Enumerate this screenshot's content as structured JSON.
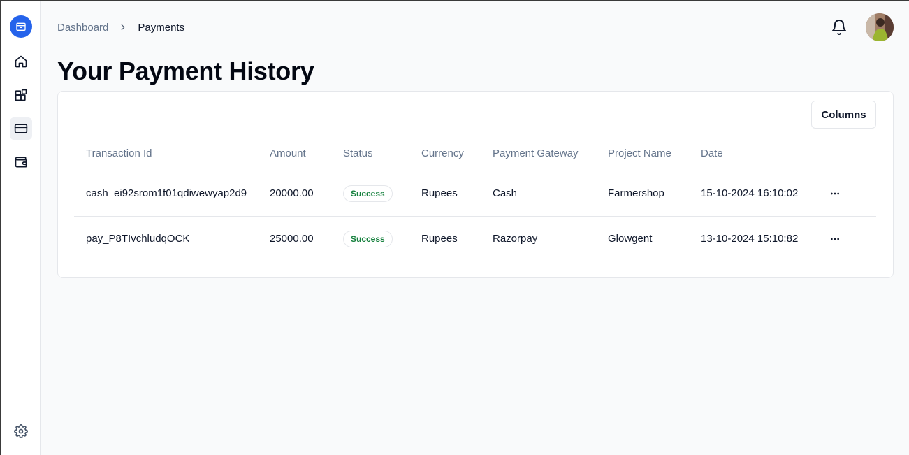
{
  "breadcrumb": {
    "parent": "Dashboard",
    "current": "Payments"
  },
  "page_title": "Your Payment History",
  "toolbar": {
    "columns_label": "Columns"
  },
  "table": {
    "headers": [
      "Transaction Id",
      "Amount",
      "Status",
      "Currency",
      "Payment Gateway",
      "Project Name",
      "Date"
    ],
    "rows": [
      {
        "transaction_id": "cash_ei92srom1f01qdiwewyap2d9",
        "amount": "20000.00",
        "status": "Success",
        "currency": "Rupees",
        "gateway": "Cash",
        "project": "Farmershop",
        "date": "15-10-2024 16:10:02"
      },
      {
        "transaction_id": "pay_P8TIvchludqOCK",
        "amount": "25000.00",
        "status": "Success",
        "currency": "Rupees",
        "gateway": "Razorpay",
        "project": "Glowgent",
        "date": "13-10-2024 15:10:82"
      }
    ]
  },
  "icons": {
    "brand": "package-icon",
    "nav": [
      "home-icon",
      "blocks-icon",
      "credit-card-icon",
      "wallet-icon"
    ],
    "settings": "gear-icon",
    "notifications": "bell-icon",
    "row_actions": "more-horizontal-icon"
  },
  "colors": {
    "accent": "#2563eb",
    "success": "#15803d"
  }
}
